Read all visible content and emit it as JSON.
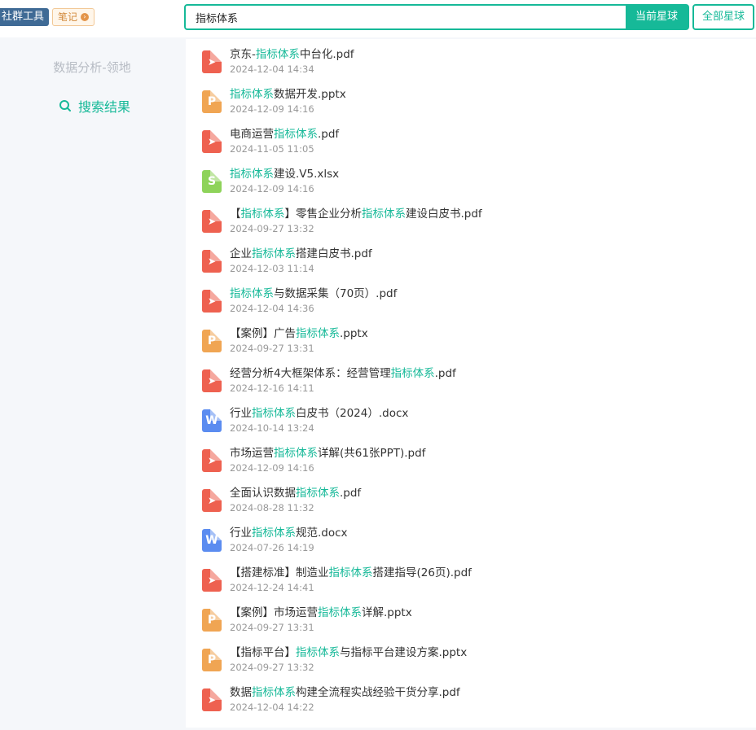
{
  "topbar": {
    "community_label": "社群工具",
    "notes_label": "笔记",
    "search_value": "指标体系",
    "btn_current": "当前星球",
    "btn_all": "全部星球"
  },
  "sidebar": {
    "group_name": "数据分析-领地",
    "nav_search_label": "搜索结果"
  },
  "colors": {
    "accent": "#16b998",
    "pdf": "#ee6150",
    "ppt": "#f0a553",
    "xls": "#8ed35a",
    "doc": "#5b8cf0"
  },
  "results": [
    {
      "type": "pdf",
      "parts": [
        "京东-",
        "指标体系",
        "中台化.pdf"
      ],
      "date": "2024-12-04 14:34"
    },
    {
      "type": "ppt",
      "parts": [
        "",
        "指标体系",
        "数据开发.pptx"
      ],
      "date": "2024-12-09 14:16"
    },
    {
      "type": "pdf",
      "parts": [
        "电商运营",
        "指标体系",
        ".pdf"
      ],
      "date": "2024-11-05 11:05"
    },
    {
      "type": "xls",
      "parts": [
        "",
        "指标体系",
        "建设.V5.xlsx"
      ],
      "date": "2024-12-09 14:16"
    },
    {
      "type": "pdf",
      "parts": [
        "【",
        "指标体系",
        "】零售企业分析",
        "指标体系",
        "建设白皮书.pdf"
      ],
      "date": "2024-09-27 13:32"
    },
    {
      "type": "pdf",
      "parts": [
        "企业",
        "指标体系",
        "搭建白皮书.pdf"
      ],
      "date": "2024-12-03 11:14"
    },
    {
      "type": "pdf",
      "parts": [
        "",
        "指标体系",
        "与数据采集（70页）.pdf"
      ],
      "date": "2024-12-04 14:36"
    },
    {
      "type": "ppt",
      "parts": [
        "【案例】广告",
        "指标体系",
        ".pptx"
      ],
      "date": "2024-09-27 13:31"
    },
    {
      "type": "pdf",
      "parts": [
        "经营分析4大框架体系：经营管理",
        "指标体系",
        ".pdf"
      ],
      "date": "2024-12-16 14:11"
    },
    {
      "type": "doc",
      "parts": [
        "行业",
        "指标体系",
        "白皮书（2024）.docx"
      ],
      "date": "2024-10-14 13:24"
    },
    {
      "type": "pdf",
      "parts": [
        "市场运营",
        "指标体系",
        "详解(共61张PPT).pdf"
      ],
      "date": "2024-12-09 14:16"
    },
    {
      "type": "pdf",
      "parts": [
        "全面认识数据",
        "指标体系",
        ".pdf"
      ],
      "date": "2024-08-28 11:32"
    },
    {
      "type": "doc",
      "parts": [
        "行业",
        "指标体系",
        "规范.docx"
      ],
      "date": "2024-07-26 14:19"
    },
    {
      "type": "pdf",
      "parts": [
        "【搭建标准】制造业",
        "指标体系",
        "搭建指导(26页).pdf"
      ],
      "date": "2024-12-24 14:41"
    },
    {
      "type": "ppt",
      "parts": [
        "【案例】市场运营",
        "指标体系",
        "详解.pptx"
      ],
      "date": "2024-09-27 13:31"
    },
    {
      "type": "ppt",
      "parts": [
        "【指标平台】",
        "指标体系",
        "与指标平台建设方案.pptx"
      ],
      "date": "2024-09-27 13:32"
    },
    {
      "type": "pdf",
      "parts": [
        "数据",
        "指标体系",
        "构建全流程实战经验干货分享.pdf"
      ],
      "date": "2024-12-04 14:22"
    }
  ]
}
